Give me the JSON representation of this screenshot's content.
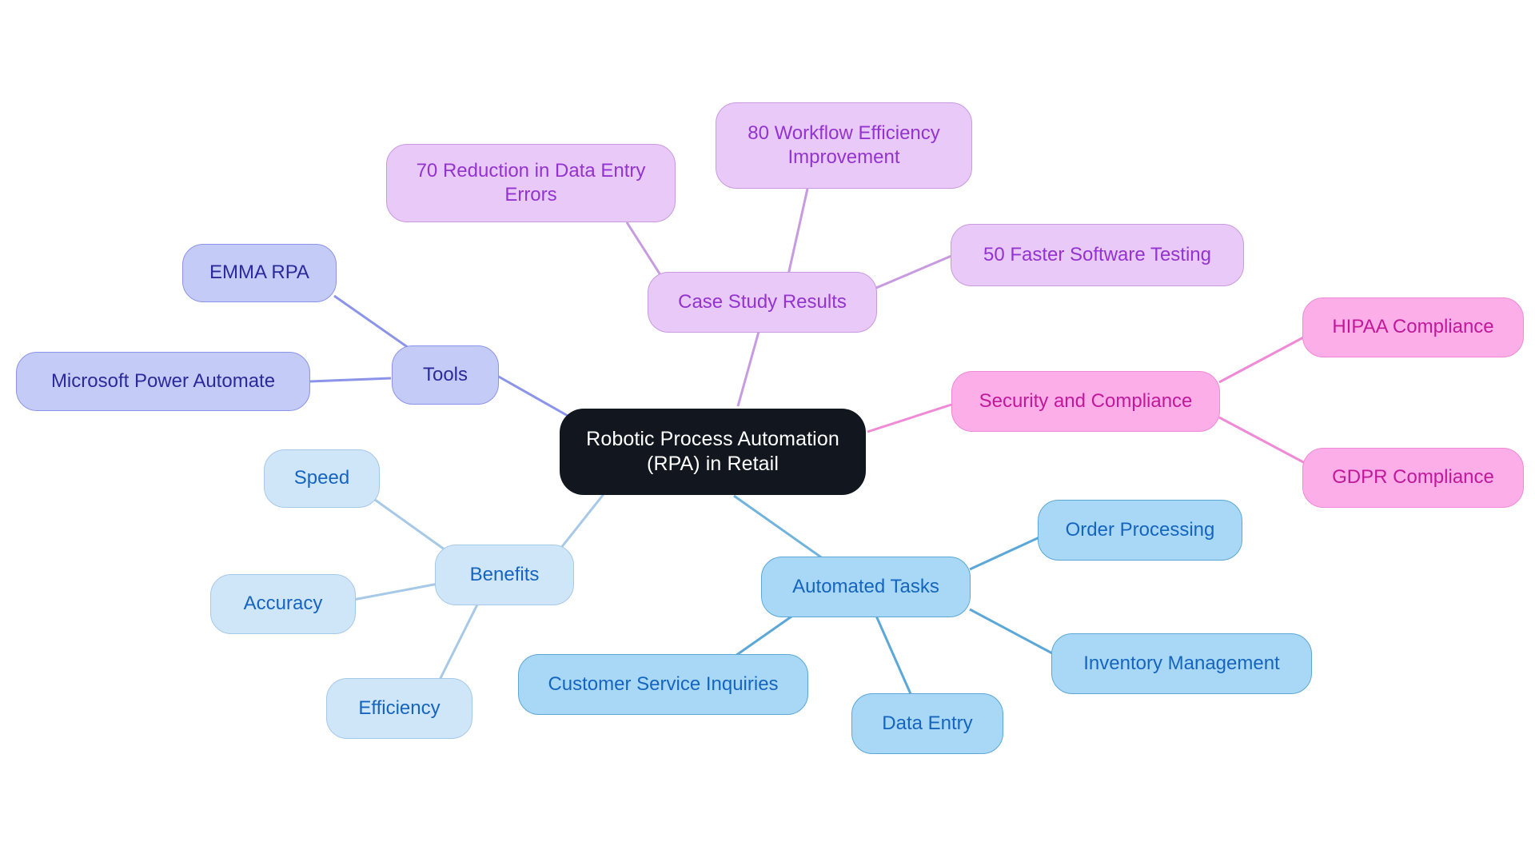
{
  "diagram": {
    "type": "mindmap",
    "title": "Robotic Process Automation (RPA) in Retail",
    "background": "#ffffff"
  },
  "palette": {
    "root_fill": "#11161f",
    "root_text": "#ffffff",
    "tools_fill": "#c5cbf7",
    "tools_border": "#8b94ea",
    "tools_text": "#2a2a9c",
    "case_fill": "#e8c9f7",
    "case_border": "#c89ae0",
    "case_text": "#9333d0",
    "security_fill": "#fbaee8",
    "security_border": "#f08ad6",
    "security_text": "#c2189a",
    "benefits_fill": "#cfe5f8",
    "benefits_border": "#a7c9e8",
    "benefits_text": "#1565c0",
    "tasks_fill": "#a8d8f5",
    "tasks_border": "#5ba7d8",
    "tasks_text": "#1565c0"
  },
  "nodes": {
    "root": {
      "label": "Robotic Process Automation\n(RPA) in Retail"
    },
    "tools": {
      "label": "Tools"
    },
    "emma_rpa": {
      "label": "EMMA RPA"
    },
    "microsoft_power_automate": {
      "label": "Microsoft Power Automate"
    },
    "case_study_results": {
      "label": "Case Study Results"
    },
    "reduction_data_entry_errors": {
      "label": "70 Reduction in Data Entry\nErrors"
    },
    "workflow_efficiency_improvement": {
      "label": "80 Workflow Efficiency\nImprovement"
    },
    "faster_software_testing": {
      "label": "50 Faster Software Testing"
    },
    "security_and_compliance": {
      "label": "Security and Compliance"
    },
    "hipaa_compliance": {
      "label": "HIPAA Compliance"
    },
    "gdpr_compliance": {
      "label": "GDPR Compliance"
    },
    "benefits": {
      "label": "Benefits"
    },
    "speed": {
      "label": "Speed"
    },
    "accuracy": {
      "label": "Accuracy"
    },
    "efficiency": {
      "label": "Efficiency"
    },
    "automated_tasks": {
      "label": "Automated Tasks"
    },
    "order_processing": {
      "label": "Order Processing"
    },
    "inventory_management": {
      "label": "Inventory Management"
    },
    "customer_service_inquiries": {
      "label": "Customer Service Inquiries"
    },
    "data_entry": {
      "label": "Data Entry"
    }
  },
  "branches": [
    {
      "key": "tools",
      "color": "#8b94ea",
      "children": [
        "emma_rpa",
        "microsoft_power_automate"
      ]
    },
    {
      "key": "case_study_results",
      "color": "#c89ae0",
      "children": [
        "reduction_data_entry_errors",
        "workflow_efficiency_improvement",
        "faster_software_testing"
      ]
    },
    {
      "key": "security_and_compliance",
      "color": "#f08ad6",
      "children": [
        "hipaa_compliance",
        "gdpr_compliance"
      ]
    },
    {
      "key": "benefits",
      "color": "#a7c9e8",
      "children": [
        "speed",
        "accuracy",
        "efficiency"
      ]
    },
    {
      "key": "automated_tasks",
      "color": "#5ba7d8",
      "children": [
        "order_processing",
        "inventory_management",
        "customer_service_inquiries",
        "data_entry"
      ]
    }
  ]
}
